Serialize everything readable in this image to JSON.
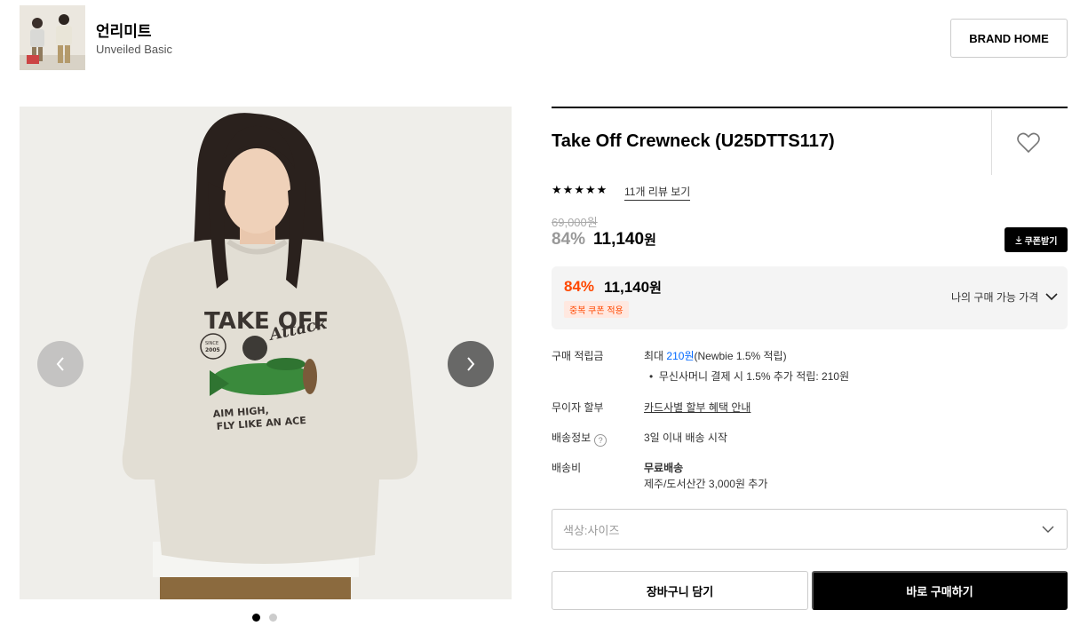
{
  "brand": {
    "name": "언리미트",
    "subtitle": "Unveiled Basic",
    "home_button": "BRAND HOME"
  },
  "gallery": {
    "print_line1": "TAKE OFF",
    "print_script": "Attack",
    "print_since": "SINCE",
    "print_year": "2005",
    "print_slogan1": "AIM HIGH,",
    "print_slogan2": "FLY LIKE AN ACE",
    "slide_count": 2,
    "active_slide": 1
  },
  "product": {
    "title": "Take Off Crewneck (U25DTTS117)",
    "rating_stars": 5,
    "review_link": "11개 리뷰 보기",
    "original_price": "69,000원",
    "discount_rate": "84%",
    "sale_price": "11,140",
    "currency": "원",
    "coupon_button": "쿠폰받기"
  },
  "best_price": {
    "rate": "84%",
    "price": "11,140",
    "currency": "원",
    "coupon_tag": "중복 쿠폰 적용",
    "my_price_label": "나의 구매 가능 가격"
  },
  "info": {
    "points_label": "구매 적립금",
    "points_prefix": "최대 ",
    "points_amount": "210원",
    "points_suffix": "(Newbie 1.5% 적립)",
    "points_bullet": "무신사머니 결제 시 1.5% 추가 적립: 210원",
    "installment_label": "무이자 할부",
    "installment_link": "카드사별 할부 혜택 안내",
    "shipping_info_label": "배송정보",
    "shipping_info_value": "3일 이내 배송 시작",
    "shipping_fee_label": "배송비",
    "shipping_fee_value": "무료배송",
    "shipping_fee_extra": "제주/도서산간 3,000원 추가"
  },
  "options": {
    "placeholder": "색상:사이즈"
  },
  "actions": {
    "cart": "장바구니 담기",
    "buy": "바로 구매하기"
  },
  "colors": {
    "accent": "#ff4800",
    "link_blue": "#0068ff",
    "black": "#000000"
  }
}
